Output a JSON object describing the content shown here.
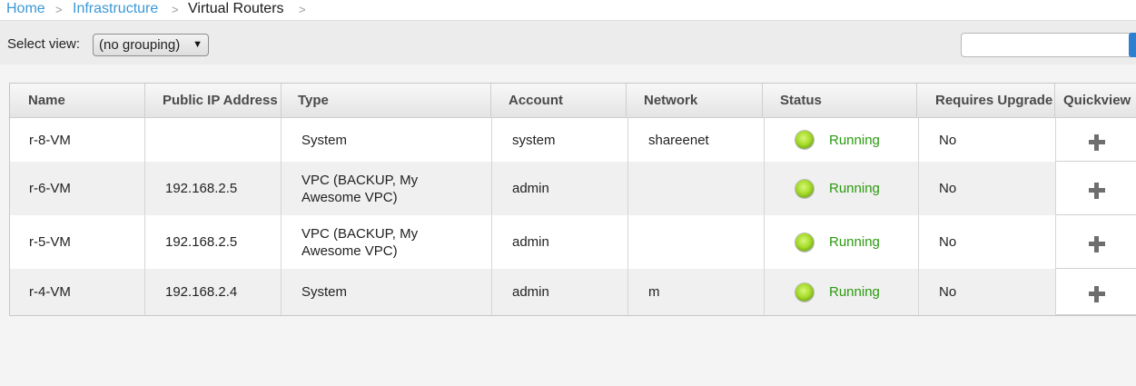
{
  "breadcrumb": {
    "items": [
      {
        "label": "Home",
        "link": true
      },
      {
        "label": "Infrastructure",
        "link": true
      },
      {
        "label": "Virtual Routers",
        "link": false
      }
    ],
    "separator": ">"
  },
  "toolbar": {
    "select_label": "Select view:",
    "select_value": "(no grouping)",
    "select_arrow": "▼",
    "search_value": ""
  },
  "table": {
    "columns": [
      "Name",
      "Public IP Address",
      "Type",
      "Account",
      "Network",
      "Status",
      "Requires Upgrade",
      "Quickview"
    ],
    "rows": [
      {
        "name": "r-8-VM",
        "public_ip": "",
        "type": "System",
        "account": "system",
        "network": "shareenet",
        "status": "Running",
        "requires_upgrade": "No"
      },
      {
        "name": "r-6-VM",
        "public_ip": "192.168.2.5",
        "type": "VPC (BACKUP, My Awesome VPC)",
        "account": "admin",
        "network": "",
        "status": "Running",
        "requires_upgrade": "No"
      },
      {
        "name": "r-5-VM",
        "public_ip": "192.168.2.5",
        "type": "VPC (BACKUP, My Awesome VPC)",
        "account": "admin",
        "network": "",
        "status": "Running",
        "requires_upgrade": "No"
      },
      {
        "name": "r-4-VM",
        "public_ip": "192.168.2.4",
        "type": "System",
        "account": "admin",
        "network": "m",
        "status": "Running",
        "requires_upgrade": "No"
      }
    ]
  },
  "colors": {
    "link": "#3c98d4",
    "status_running": "#2a9a10",
    "status_dot": "#a8dc2a"
  },
  "icons": {
    "status": "status-light-icon",
    "quickview": "plus-icon"
  }
}
